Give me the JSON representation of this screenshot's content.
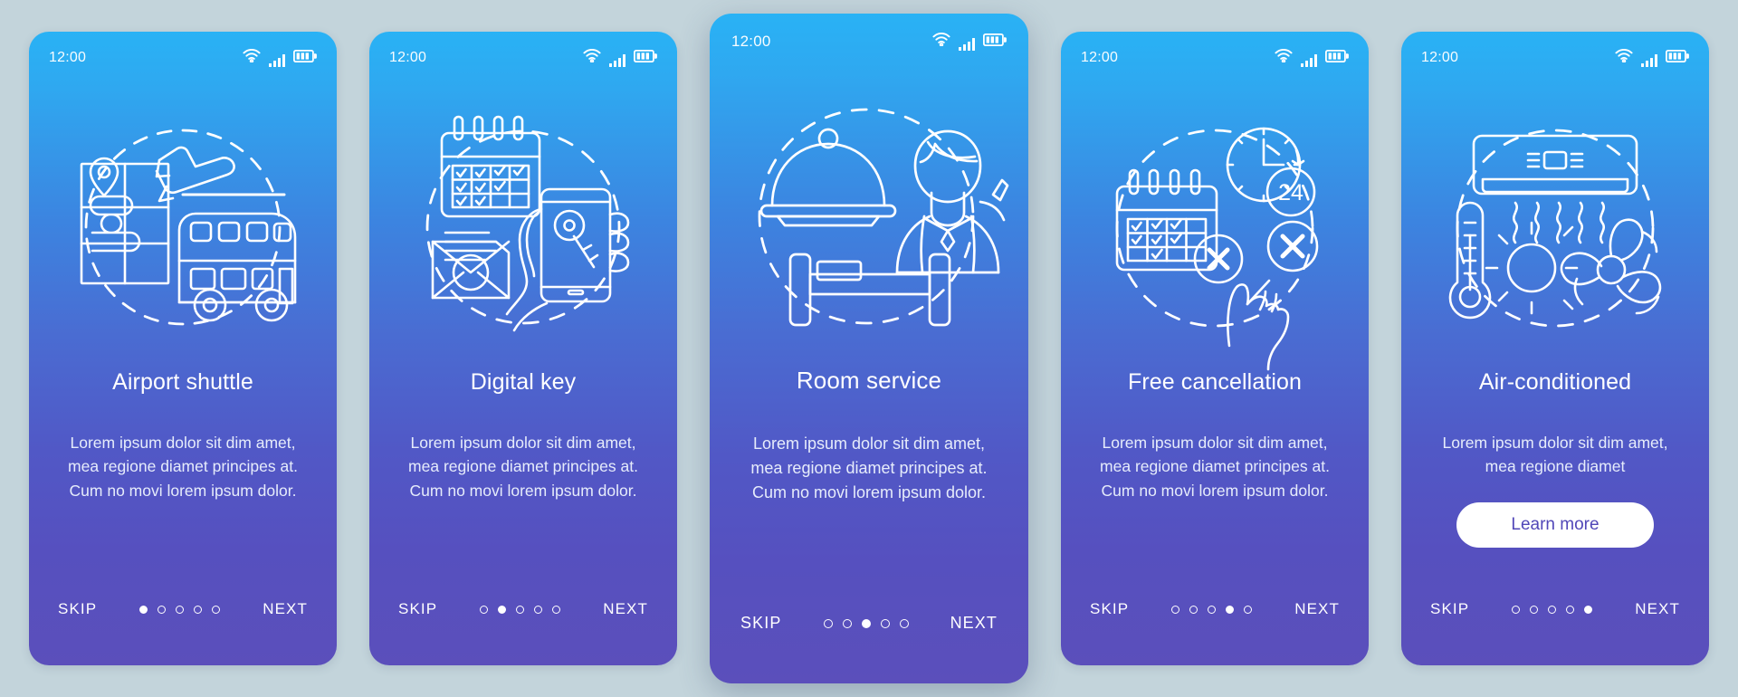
{
  "background_color": "#c3d4db",
  "card_gradient": {
    "top": "#29b2f5",
    "bottom": "#5b4fbb"
  },
  "status_bar": {
    "time": "12:00",
    "icons": [
      "wifi-icon",
      "cellular-signal-icon",
      "battery-icon"
    ]
  },
  "common": {
    "skip_label": "SKIP",
    "next_label": "NEXT",
    "dot_count": 5
  },
  "screens": [
    {
      "id": "airport-shuttle",
      "title": "Airport shuttle",
      "body": "Lorem ipsum dolor sit dim amet, mea regione diamet principes at. Cum no movi lorem ipsum dolor.",
      "illustration": "airport-shuttle-illustration",
      "illustration_parts": [
        "map-with-pin-icon",
        "double-decker-bus-icon",
        "airplane-icon",
        "dashed-circle"
      ],
      "active_dot": 1,
      "featured": false,
      "cta_label": null
    },
    {
      "id": "digital-key",
      "title": "Digital key",
      "body": "Lorem ipsum dolor sit dim amet, mea regione diamet principes at. Cum no movi lorem ipsum dolor.",
      "illustration": "digital-key-illustration",
      "illustration_parts": [
        "calendar-checkmarks-icon",
        "envelope-letter-icon",
        "hand-phone-key-icon",
        "dashed-circle"
      ],
      "active_dot": 2,
      "featured": false,
      "cta_label": null
    },
    {
      "id": "room-service",
      "title": "Room service",
      "body": "Lorem ipsum dolor sit dim amet, mea regione diamet principes at. Cum no movi lorem ipsum dolor.",
      "illustration": "room-service-illustration",
      "illustration_parts": [
        "food-cloche-icon",
        "bed-icon",
        "housekeeper-icon",
        "dashed-circle"
      ],
      "active_dot": 3,
      "featured": true,
      "cta_label": null
    },
    {
      "id": "free-cancellation",
      "title": "Free cancellation",
      "body": "Lorem ipsum dolor sit dim amet, mea regione diamet principes at. Cum no movi lorem ipsum dolor.",
      "illustration": "free-cancellation-illustration",
      "illustration_parts": [
        "calendar-cancel-icon",
        "clock-24h-icon",
        "cross-button-icon",
        "pointing-hand-icon",
        "dashed-circle"
      ],
      "active_dot": 4,
      "featured": false,
      "cta_label": null
    },
    {
      "id": "air-conditioned",
      "title": "Air-conditioned",
      "body": "Lorem ipsum dolor sit dim amet, mea regione diamet",
      "illustration": "air-conditioned-illustration",
      "illustration_parts": [
        "ac-unit-icon",
        "thermometer-icon",
        "sun-icon",
        "fan-icon",
        "dashed-circle"
      ],
      "active_dot": 5,
      "featured": false,
      "cta_label": "Learn more"
    }
  ]
}
